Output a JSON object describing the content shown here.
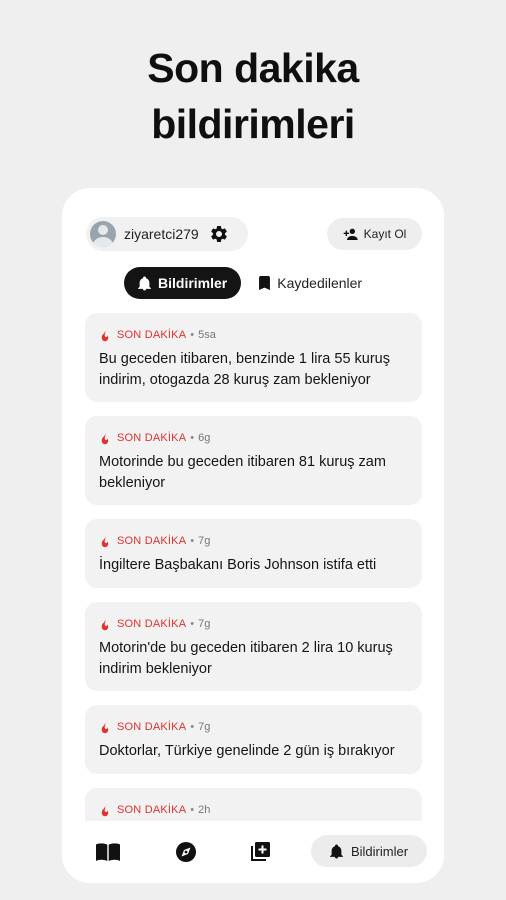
{
  "headline": {
    "line1": "Son dakika",
    "line2": "bildirimleri"
  },
  "header": {
    "username": "ziyaretci279",
    "register_label": "Kayıt Ol"
  },
  "tabs": [
    {
      "label": "Bildirimler",
      "active": true
    },
    {
      "label": "Kaydedilenler",
      "active": false
    }
  ],
  "notifications": [
    {
      "tag": "SON DAKİKA",
      "time": "5sa",
      "title": "Bu geceden itibaren, benzinde 1 lira 55 kuruş indirim, otogazda 28 kuruş zam bekleniyor"
    },
    {
      "tag": "SON DAKİKA",
      "time": "6g",
      "title": "Motorinde bu geceden itibaren 81 kuruş zam bekleniyor"
    },
    {
      "tag": "SON DAKİKA",
      "time": "7g",
      "title": "İngiltere Başbakanı Boris Johnson istifa etti"
    },
    {
      "tag": "SON DAKİKA",
      "time": "7g",
      "title": "Motorin'de bu geceden itibaren 2 lira 10 kuruş indirim bekleniyor"
    },
    {
      "tag": "SON DAKİKA",
      "time": "7g",
      "title": "Doktorlar, Türkiye genelinde 2 gün iş bırakıyor"
    },
    {
      "tag": "SON DAKİKA",
      "time": "2h",
      "title": ""
    }
  ],
  "bottom_nav": {
    "items": [
      "book-icon",
      "compass-icon",
      "add-library-icon"
    ],
    "active_label": "Bildirimler"
  },
  "colors": {
    "accent_red": "#e0322e",
    "active_tab_bg": "#141414"
  }
}
